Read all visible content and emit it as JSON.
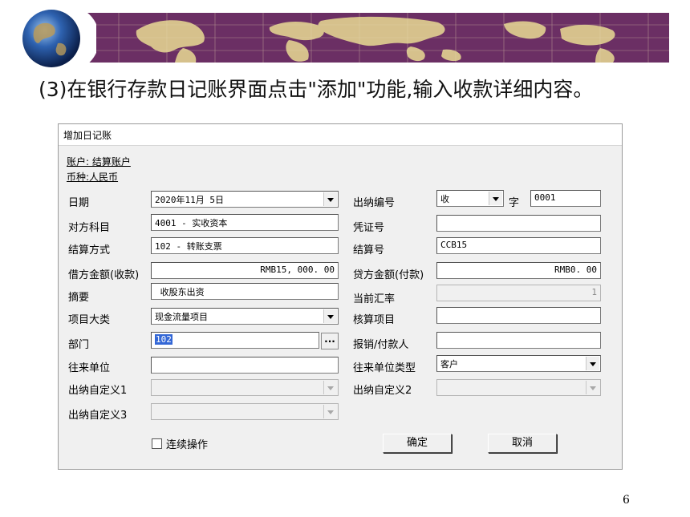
{
  "slide": {
    "headline": "(3)在银行存款日记账界面点击\"添加\"功能,输入收款详细内容。",
    "page_number": "6"
  },
  "dialog": {
    "title": "增加日记账",
    "account": "账户: 结算账户",
    "currency": "币种:人民币",
    "left": {
      "date_label": "日期",
      "date_value": "2020年11月 5日",
      "subject_label": "对方科目",
      "subject_value": "4001 - 实收资本",
      "settle_method_label": "结算方式",
      "settle_method_value": "102 - 转账支票",
      "debit_label": "借方金额(收款)",
      "debit_value": "RMB15, 000. 00",
      "summary_label": "摘要",
      "summary_value": "收股东出资",
      "project_class_label": "项目大类",
      "project_class_value": "现金流量项目",
      "dept_label": "部门",
      "dept_value": "102",
      "dept_btn": "...",
      "partner_label": "往来单位",
      "custom1_label": "出纳自定义1",
      "custom3_label": "出纳自定义3"
    },
    "right": {
      "cashier_no_label": "出纳编号",
      "cashier_type_value": "收",
      "zi_label": "字",
      "cashier_no_value": "0001",
      "voucher_label": "凭证号",
      "settle_no_label": "结算号",
      "settle_no_value": "CCB15",
      "credit_label": "贷方金额(付款)",
      "credit_value": "RMB0. 00",
      "rate_label": "当前汇率",
      "rate_value": "1",
      "audit_item_label": "核算项目",
      "reimburse_label": "报销/付款人",
      "partner_type_label": "往来单位类型",
      "partner_type_value": "客户",
      "custom2_label": "出纳自定义2"
    },
    "continuous_label": "连续操作",
    "ok_label": "确定",
    "cancel_label": "取消"
  },
  "icons": {
    "globe": "globe-icon",
    "dropdown": "chevron-down-icon"
  },
  "colors": {
    "banner": "#6b2f64",
    "map_land": "#d6c18c",
    "selection": "#3367d6"
  }
}
